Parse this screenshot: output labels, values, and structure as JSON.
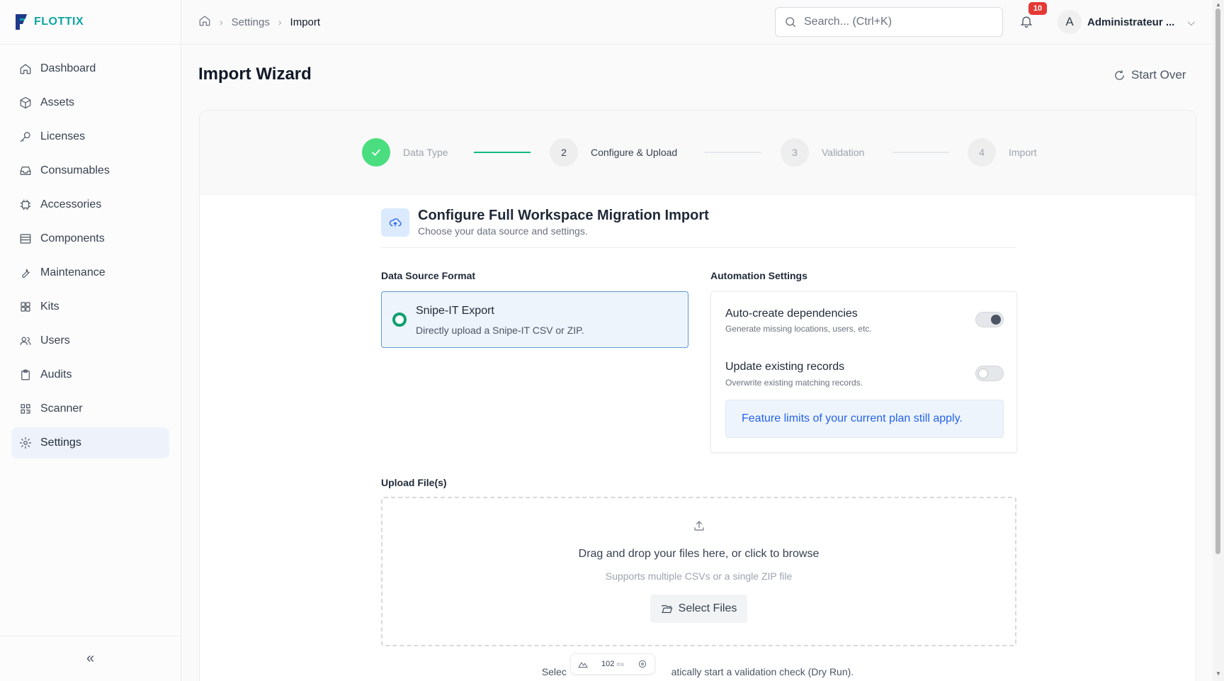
{
  "brand": {
    "name": "FLOTTIX",
    "accent": "#0ea5a4"
  },
  "sidebar": {
    "items": [
      {
        "label": "Dashboard",
        "icon": "home-icon"
      },
      {
        "label": "Assets",
        "icon": "cube-icon"
      },
      {
        "label": "Licenses",
        "icon": "key-icon"
      },
      {
        "label": "Consumables",
        "icon": "inbox-icon"
      },
      {
        "label": "Accessories",
        "icon": "chip-icon"
      },
      {
        "label": "Components",
        "icon": "server-icon"
      },
      {
        "label": "Maintenance",
        "icon": "wrench-icon"
      },
      {
        "label": "Kits",
        "icon": "grid-icon"
      },
      {
        "label": "Users",
        "icon": "users-icon"
      },
      {
        "label": "Audits",
        "icon": "clipboard-icon"
      },
      {
        "label": "Scanner",
        "icon": "qr-icon"
      },
      {
        "label": "Settings",
        "icon": "gear-icon",
        "active": true
      }
    ],
    "collapse_label": "«"
  },
  "topbar": {
    "breadcrumb": [
      "Settings",
      "Import"
    ],
    "search_placeholder": "Search... (Ctrl+K)",
    "notification_count": "10",
    "user_initial": "A",
    "user_name": "Administrateur ..."
  },
  "page": {
    "title": "Import Wizard",
    "start_over": "Start Over"
  },
  "stepper": {
    "steps": [
      {
        "number": "",
        "label": "Data Type",
        "status": "done"
      },
      {
        "number": "2",
        "label": "Configure & Upload",
        "status": "active"
      },
      {
        "number": "3",
        "label": "Validation",
        "status": "pending"
      },
      {
        "number": "4",
        "label": "Import",
        "status": "pending"
      }
    ]
  },
  "config": {
    "title": "Configure Full Workspace Migration Import",
    "subtitle": "Choose your data source and settings.",
    "source_label": "Data Source Format",
    "source_option": {
      "title": "Snipe-IT Export",
      "description": "Directly upload a Snipe-IT CSV or ZIP."
    },
    "automation_label": "Automation Settings",
    "settings": [
      {
        "title": "Auto-create dependencies",
        "description": "Generate missing locations, users, etc.",
        "enabled": true
      },
      {
        "title": "Update existing records",
        "description": "Overwrite existing matching records.",
        "enabled": false
      }
    ],
    "plan_note": "Feature limits of your current plan still apply."
  },
  "upload": {
    "label": "Upload File(s)",
    "title": "Drag and drop your files here, or click to browse",
    "subtitle": "Supports multiple CSVs or a single ZIP file",
    "button": "Select Files",
    "footnote": "Selec                                      atically start a validation check (Dry Run)."
  },
  "perf": {
    "value": "102",
    "unit": "ms"
  }
}
